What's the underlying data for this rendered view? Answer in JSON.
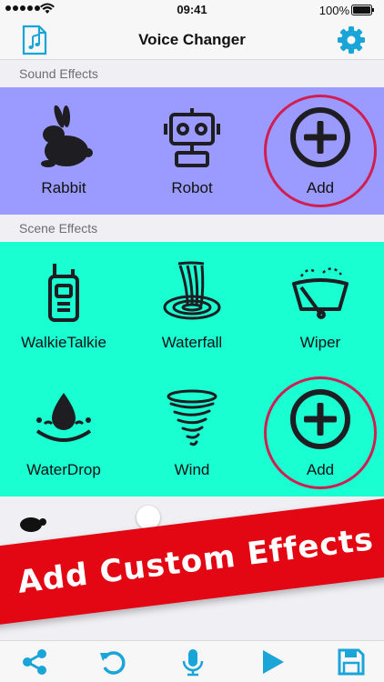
{
  "status_bar": {
    "time": "09:41",
    "battery": "100%"
  },
  "nav": {
    "title": "Voice Changer",
    "left_icon": "music-file-icon",
    "right_icon": "gear-icon"
  },
  "sections": {
    "sound": "Sound Effects",
    "scene": "Scene Effects"
  },
  "sound_effects": [
    {
      "label": "Rabbit",
      "icon": "rabbit-icon"
    },
    {
      "label": "Robot",
      "icon": "robot-icon"
    },
    {
      "label": "Add",
      "icon": "add-circle-icon"
    }
  ],
  "scene_effects": [
    {
      "label": "WalkieTalkie",
      "icon": "walkie-talkie-icon"
    },
    {
      "label": "Waterfall",
      "icon": "waterfall-icon"
    },
    {
      "label": "Wiper",
      "icon": "wiper-icon"
    },
    {
      "label": "WaterDrop",
      "icon": "water-drop-icon"
    },
    {
      "label": "Wind",
      "icon": "tornado-icon"
    },
    {
      "label": "Add",
      "icon": "add-circle-icon"
    }
  ],
  "promo": {
    "text": "Add Custom Effects"
  },
  "colors": {
    "sound_panel": "#9b9bff",
    "scene_panel": "#19ffd2",
    "accent": "#1aa5d8",
    "ring": "#d11e52",
    "banner": "#e30613"
  },
  "toolbar": [
    "share-icon",
    "undo-icon",
    "microphone-icon",
    "play-icon",
    "save-icon"
  ]
}
